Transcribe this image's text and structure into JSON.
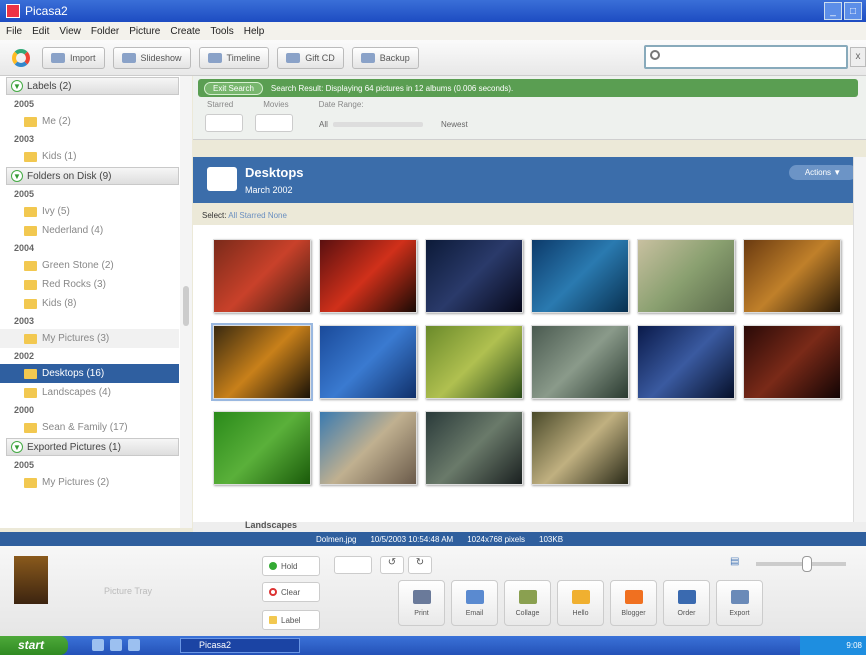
{
  "window": {
    "title": "Picasa2",
    "controls": [
      "_",
      "□"
    ]
  },
  "menu": [
    "File",
    "Edit",
    "View",
    "Folder",
    "Picture",
    "Create",
    "Tools",
    "Help"
  ],
  "toolbar": {
    "buttons": [
      {
        "label": "Import",
        "icon": "import-icon"
      },
      {
        "label": "Slideshow",
        "icon": "slideshow-icon"
      },
      {
        "label": "Timeline",
        "icon": "timeline-icon"
      },
      {
        "label": "Gift CD",
        "icon": "giftcd-icon"
      },
      {
        "label": "Backup",
        "icon": "backup-icon"
      }
    ],
    "search_value": "",
    "search_clear": "x"
  },
  "sidebar": {
    "labels_header": "Labels (2)",
    "folders_header": "Folders on Disk (9)",
    "exported_header": "Exported Pictures (1)",
    "labels": [
      {
        "year": "2005",
        "items": [
          "Me (2)"
        ]
      },
      {
        "year": "2003",
        "items": [
          "Kids (1)"
        ]
      }
    ],
    "folders": [
      {
        "year": "2005",
        "items": [
          "Ivy (5)",
          "Nederland (4)"
        ]
      },
      {
        "year": "2004",
        "items": [
          "Green Stone (2)",
          "Red Rocks (3)",
          "Kids (8)"
        ]
      },
      {
        "year": "2003",
        "items": [
          "My Pictures (3)"
        ]
      },
      {
        "year": "2002",
        "items": [
          "Desktops (16)",
          "Landscapes (4)"
        ]
      },
      {
        "year": "2000",
        "items": [
          "Sean & Family (17)"
        ]
      }
    ],
    "exported": [
      {
        "year": "2005",
        "items": [
          "My Pictures (2)"
        ]
      }
    ]
  },
  "search_results": {
    "exit_label": "Exit Search",
    "result_text": "Search Result: Displaying 64 pictures in 12 albums (0.006 seconds).",
    "filters": [
      "Starred",
      "Movies",
      "Date Range:"
    ],
    "range_start": "All",
    "range_end": "Newest"
  },
  "album": {
    "name": "Desktops",
    "date": "March 2002",
    "actions": "Actions ▼",
    "select_label": "Select:",
    "select_options": "All Starred None",
    "next_album": "Landscapes"
  },
  "thumbnails": [
    {
      "colors": [
        "#7a2a1a",
        "#c9412a",
        "#3a1a10"
      ]
    },
    {
      "colors": [
        "#5a1010",
        "#d0301a",
        "#1a0a05"
      ]
    },
    {
      "colors": [
        "#0c1a38",
        "#2a3a6a",
        "#06081a"
      ]
    },
    {
      "colors": [
        "#0c3a6a",
        "#2a7ab0",
        "#083050"
      ]
    },
    {
      "colors": [
        "#c8c0a0",
        "#8aa070",
        "#5a6a4a"
      ]
    },
    {
      "colors": [
        "#6a3a10",
        "#c0802a",
        "#2a1a08"
      ]
    },
    {
      "colors": [
        "#3a2a10",
        "#c8801a",
        "#1a1208"
      ]
    },
    {
      "colors": [
        "#1a4a9a",
        "#3a7ad0",
        "#10306a"
      ]
    },
    {
      "colors": [
        "#6a8a2a",
        "#b0c050",
        "#2a4a1a"
      ]
    },
    {
      "colors": [
        "#4a5a50",
        "#8a9a8a",
        "#2a3a30"
      ]
    },
    {
      "colors": [
        "#0a1a4a",
        "#3a5aa0",
        "#06102a"
      ]
    },
    {
      "colors": [
        "#2a0a08",
        "#7a2a18",
        "#120404"
      ]
    },
    {
      "colors": [
        "#2a8a1a",
        "#5ab03a",
        "#1a5a0a"
      ]
    },
    {
      "colors": [
        "#3a7ab0",
        "#c0b090",
        "#6a5a4a"
      ]
    },
    {
      "colors": [
        "#2a3a3a",
        "#6a7a6a",
        "#1a2020"
      ]
    },
    {
      "colors": [
        "#4a4a2a",
        "#c0b080",
        "#2a2a18"
      ]
    }
  ],
  "status": {
    "file": "Dolmen.jpg",
    "date": "10/5/2003 10:54:48 AM",
    "dims": "1024x768 pixels",
    "size": "103KB"
  },
  "tray": {
    "label": "Picture Tray",
    "hold": "Hold",
    "clear": "Clear",
    "label_btn": "Label",
    "rotate_left": "↺",
    "rotate_right": "↻",
    "actions": [
      {
        "label": "Print",
        "color": "#6a7a9a"
      },
      {
        "label": "Email",
        "color": "#5a8ad0"
      },
      {
        "label": "Collage",
        "color": "#8aa050"
      },
      {
        "label": "Hello",
        "color": "#f0b030"
      },
      {
        "label": "Blogger",
        "color": "#f07020"
      },
      {
        "label": "Order",
        "color": "#3a6ab0"
      },
      {
        "label": "Export",
        "color": "#6a8ab8"
      }
    ]
  },
  "taskbar": {
    "start": "start",
    "task": "Picasa2",
    "clock": "9:08"
  }
}
